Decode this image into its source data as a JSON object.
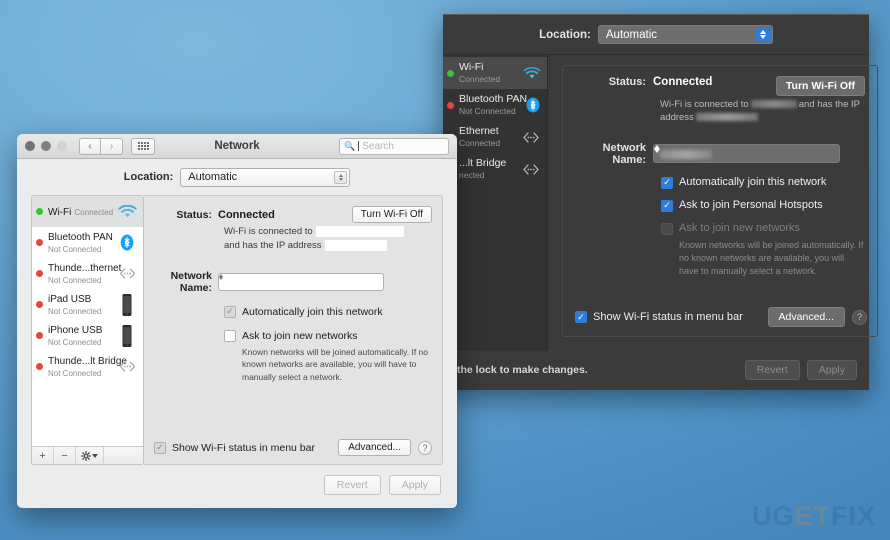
{
  "watermark": {
    "u": "U",
    "g": "G",
    "e": "E",
    "t": "T",
    "f": "FIX"
  },
  "dark_window": {
    "location": {
      "label": "Location:",
      "value": "Automatic"
    },
    "sidebar": [
      {
        "name": "Wi-Fi",
        "status": "Connected",
        "dot": "green",
        "icon": "wifi-icon",
        "selected": true
      },
      {
        "name": "Bluetooth PAN",
        "status": "Not Connected",
        "dot": "red",
        "icon": "bluetooth-icon",
        "selected": false
      },
      {
        "name": "Ethernet",
        "status": "Connected",
        "dot": "red",
        "icon": "thunderbolt-icon",
        "selected": false
      },
      {
        "name": "...lt Bridge",
        "status": "nected",
        "dot": "red",
        "icon": "thunderbolt-icon",
        "selected": false
      }
    ],
    "status": {
      "label": "Status:",
      "value": "Connected",
      "button": "Turn Wi-Fi Off"
    },
    "description_pre": "Wi-Fi is connected to",
    "description_mid": "and has the IP",
    "description_post": "address",
    "network_name": {
      "label": "Network Name:"
    },
    "checkboxes": [
      {
        "label": "Automatically join this network",
        "checked": true,
        "dim": false
      },
      {
        "label": "Ask to join Personal Hotspots",
        "checked": true,
        "dim": false
      },
      {
        "label": "Ask to join new networks",
        "checked": false,
        "dim": true
      }
    ],
    "help_text": "Known networks will be joined automatically. If no known networks are available, you will have to manually select a network.",
    "show_status": {
      "label": "Show Wi-Fi status in menu bar",
      "checked": true
    },
    "advanced_button": "Advanced...",
    "help_button": "?",
    "footer": {
      "lock_text": "the lock to make changes.",
      "revert": "Revert",
      "apply": "Apply"
    }
  },
  "light_window": {
    "titlebar": {
      "title": "Network",
      "back": "‹",
      "forward": "›"
    },
    "search": {
      "placeholder": "Search"
    },
    "location": {
      "label": "Location:",
      "value": "Automatic"
    },
    "sidebar": [
      {
        "name": "Wi-Fi",
        "status": "Connected",
        "dot": "green",
        "icon": "wifi-icon",
        "selected": true
      },
      {
        "name": "Bluetooth PAN",
        "status": "Not Connected",
        "dot": "red",
        "icon": "bluetooth-icon",
        "selected": false
      },
      {
        "name": "Thunde...thernet",
        "status": "Not Connected",
        "dot": "red",
        "icon": "thunderbolt-icon",
        "selected": false
      },
      {
        "name": "iPad USB",
        "status": "Not Connected",
        "dot": "red",
        "icon": "ipad-icon",
        "selected": false
      },
      {
        "name": "iPhone USB",
        "status": "Not Connected",
        "dot": "red",
        "icon": "iphone-icon",
        "selected": false
      },
      {
        "name": "Thunde...lt Bridge",
        "status": "Not Connected",
        "dot": "red",
        "icon": "thunderbolt-icon",
        "selected": false
      }
    ],
    "sidebar_footer": {
      "add": "+",
      "remove": "−",
      "gear": "gear-icon"
    },
    "status": {
      "label": "Status:",
      "value": "Connected",
      "button": "Turn Wi-Fi Off"
    },
    "description_line1": "Wi-Fi is connected to",
    "description_line2": "and has the IP address",
    "network_name": {
      "label": "Network Name:"
    },
    "checkboxes": [
      {
        "label": "Automatically join this network",
        "checked": true
      },
      {
        "label": "Ask to join new networks",
        "checked": false
      }
    ],
    "help_text": "Known networks will be joined automatically. If no known networks are available, you will have to manually select a network.",
    "show_status": {
      "label": "Show Wi-Fi status in menu bar",
      "checked": true
    },
    "advanced_button": "Advanced...",
    "help_button": "?",
    "footer": {
      "revert": "Revert",
      "apply": "Apply"
    }
  }
}
